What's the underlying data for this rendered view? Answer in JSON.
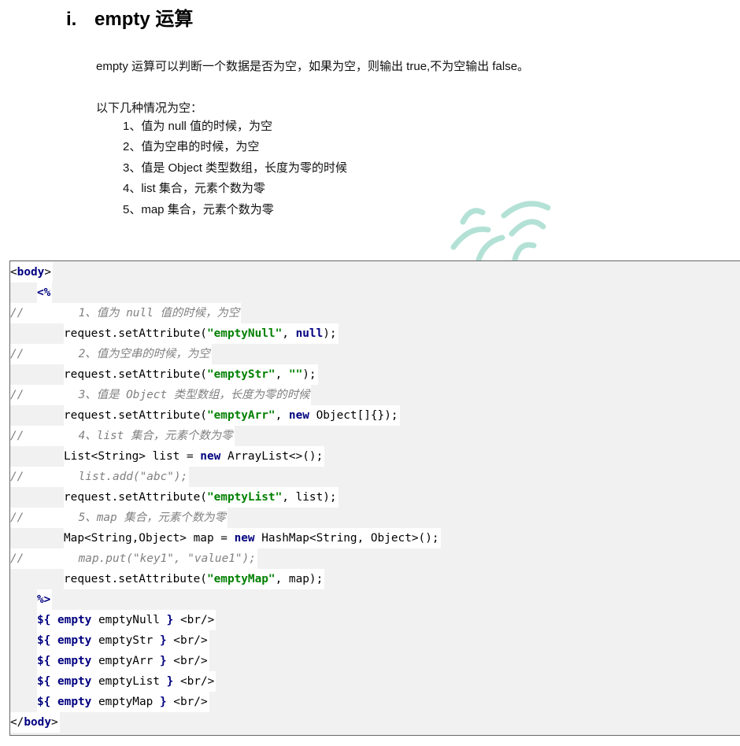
{
  "heading": {
    "number": "i.",
    "title": "empty 运算"
  },
  "intro": "empty 运算可以判断一个数据是否为空，如果为空，则输出 true,不为空输出 false。",
  "cases_intro": "以下几种情况为空：",
  "cases": [
    "1、值为 null 值的时候，为空",
    "2、值为空串的时候，为空",
    "3、值是 Object 类型数组，长度为零的时候",
    "4、list 集合，元素个数为零",
    "5、map 集合，元素个数为零"
  ],
  "code": {
    "body_open": [
      "<",
      "body",
      ">"
    ],
    "scriptlet_open": "<%",
    "comment_prefix": "//",
    "c1": "1、值为 null 值的时候，为空",
    "l1": [
      "request.setAttribute(",
      "\"emptyNull\"",
      ", ",
      "null",
      ");"
    ],
    "c2": "2、值为空串的时候，为空",
    "l2": [
      "request.setAttribute(",
      "\"emptyStr\"",
      ", ",
      "\"\"",
      ");"
    ],
    "c3": "3、值是 Object 类型数组，长度为零的时候",
    "l3": [
      "request.setAttribute(",
      "\"emptyArr\"",
      ", ",
      "new",
      " Object[]{});"
    ],
    "c4": "4、list 集合，元素个数为零",
    "l4": [
      "List<String> list = ",
      "new",
      " ArrayList<>();"
    ],
    "c4b": "list.add(\"abc\");",
    "l5": [
      "request.setAttribute(",
      "\"emptyList\"",
      ", list);"
    ],
    "c5": "5、map 集合，元素个数为零",
    "l6": [
      "Map<String,Object> map = ",
      "new",
      " HashMap<String, Object>();"
    ],
    "c5b": "map.put(\"key1\", \"value1\");",
    "l7": [
      "request.setAttribute(",
      "\"emptyMap\"",
      ", map);"
    ],
    "scriptlet_close": "%>",
    "el_lines": [
      {
        "open": "${",
        "kw": "empty",
        "var": " emptyNull ",
        "close": "}",
        "br": " <br/>"
      },
      {
        "open": "${",
        "kw": "empty",
        "var": " emptyStr ",
        "close": "}",
        "br": " <br/>"
      },
      {
        "open": "${",
        "kw": "empty",
        "var": " emptyArr ",
        "close": "}",
        "br": " <br/>"
      },
      {
        "open": "${",
        "kw": "empty",
        "var": " emptyList ",
        "close": "}",
        "br": " <br/>"
      },
      {
        "open": "${",
        "kw": "empty",
        "var": " emptyMap ",
        "close": "}",
        "br": " <br/>"
      }
    ],
    "body_close": [
      "</",
      "body",
      ">"
    ]
  }
}
